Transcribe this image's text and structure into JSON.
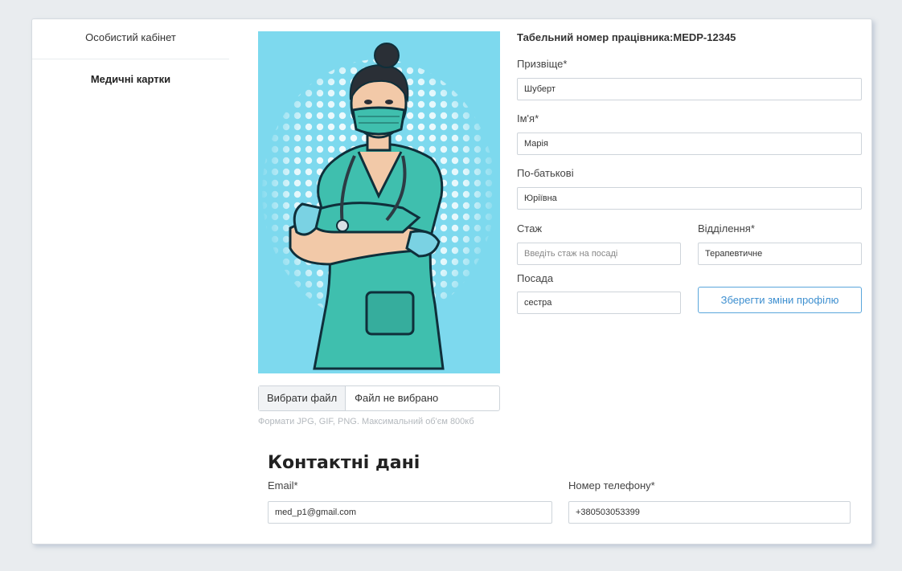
{
  "sidebar": {
    "items": [
      {
        "label": "Особистий кабінет"
      },
      {
        "label": "Медичні картки"
      }
    ]
  },
  "photo": {
    "file_button_label": "Вибрати файл",
    "file_status": "Файл не вибрано",
    "hint": "Формати JPG, GIF, PNG. Максимальний об'єм 800кб"
  },
  "profile": {
    "employee_id_label": "Табельний номер працівника:",
    "employee_id_value": "MEDP-12345",
    "surname": {
      "label": "Призвіще*",
      "value": "Шуберт"
    },
    "name": {
      "label": "Ім'я*",
      "value": "Марія"
    },
    "patronymic": {
      "label": "По-батькові",
      "value": "Юріївна"
    },
    "experience": {
      "label": "Стаж",
      "value": "",
      "placeholder": "Введіть стаж на посаді"
    },
    "department": {
      "label": "Відділення*",
      "value": "Терапевтичне"
    },
    "position": {
      "label": "Посада",
      "value": "сестра"
    },
    "save_button_label": "Зберегти зміни профілю"
  },
  "contacts": {
    "title": "Контактні дані",
    "email": {
      "label": "Email*",
      "value": "med_p1@gmail.com"
    },
    "phone": {
      "label": "Номер телефону*",
      "value": "+380503053399"
    }
  },
  "colors": {
    "photo_bg": "#7dd9ee",
    "scrubs": "#3fbfae",
    "accent": "#3d8fd0"
  }
}
